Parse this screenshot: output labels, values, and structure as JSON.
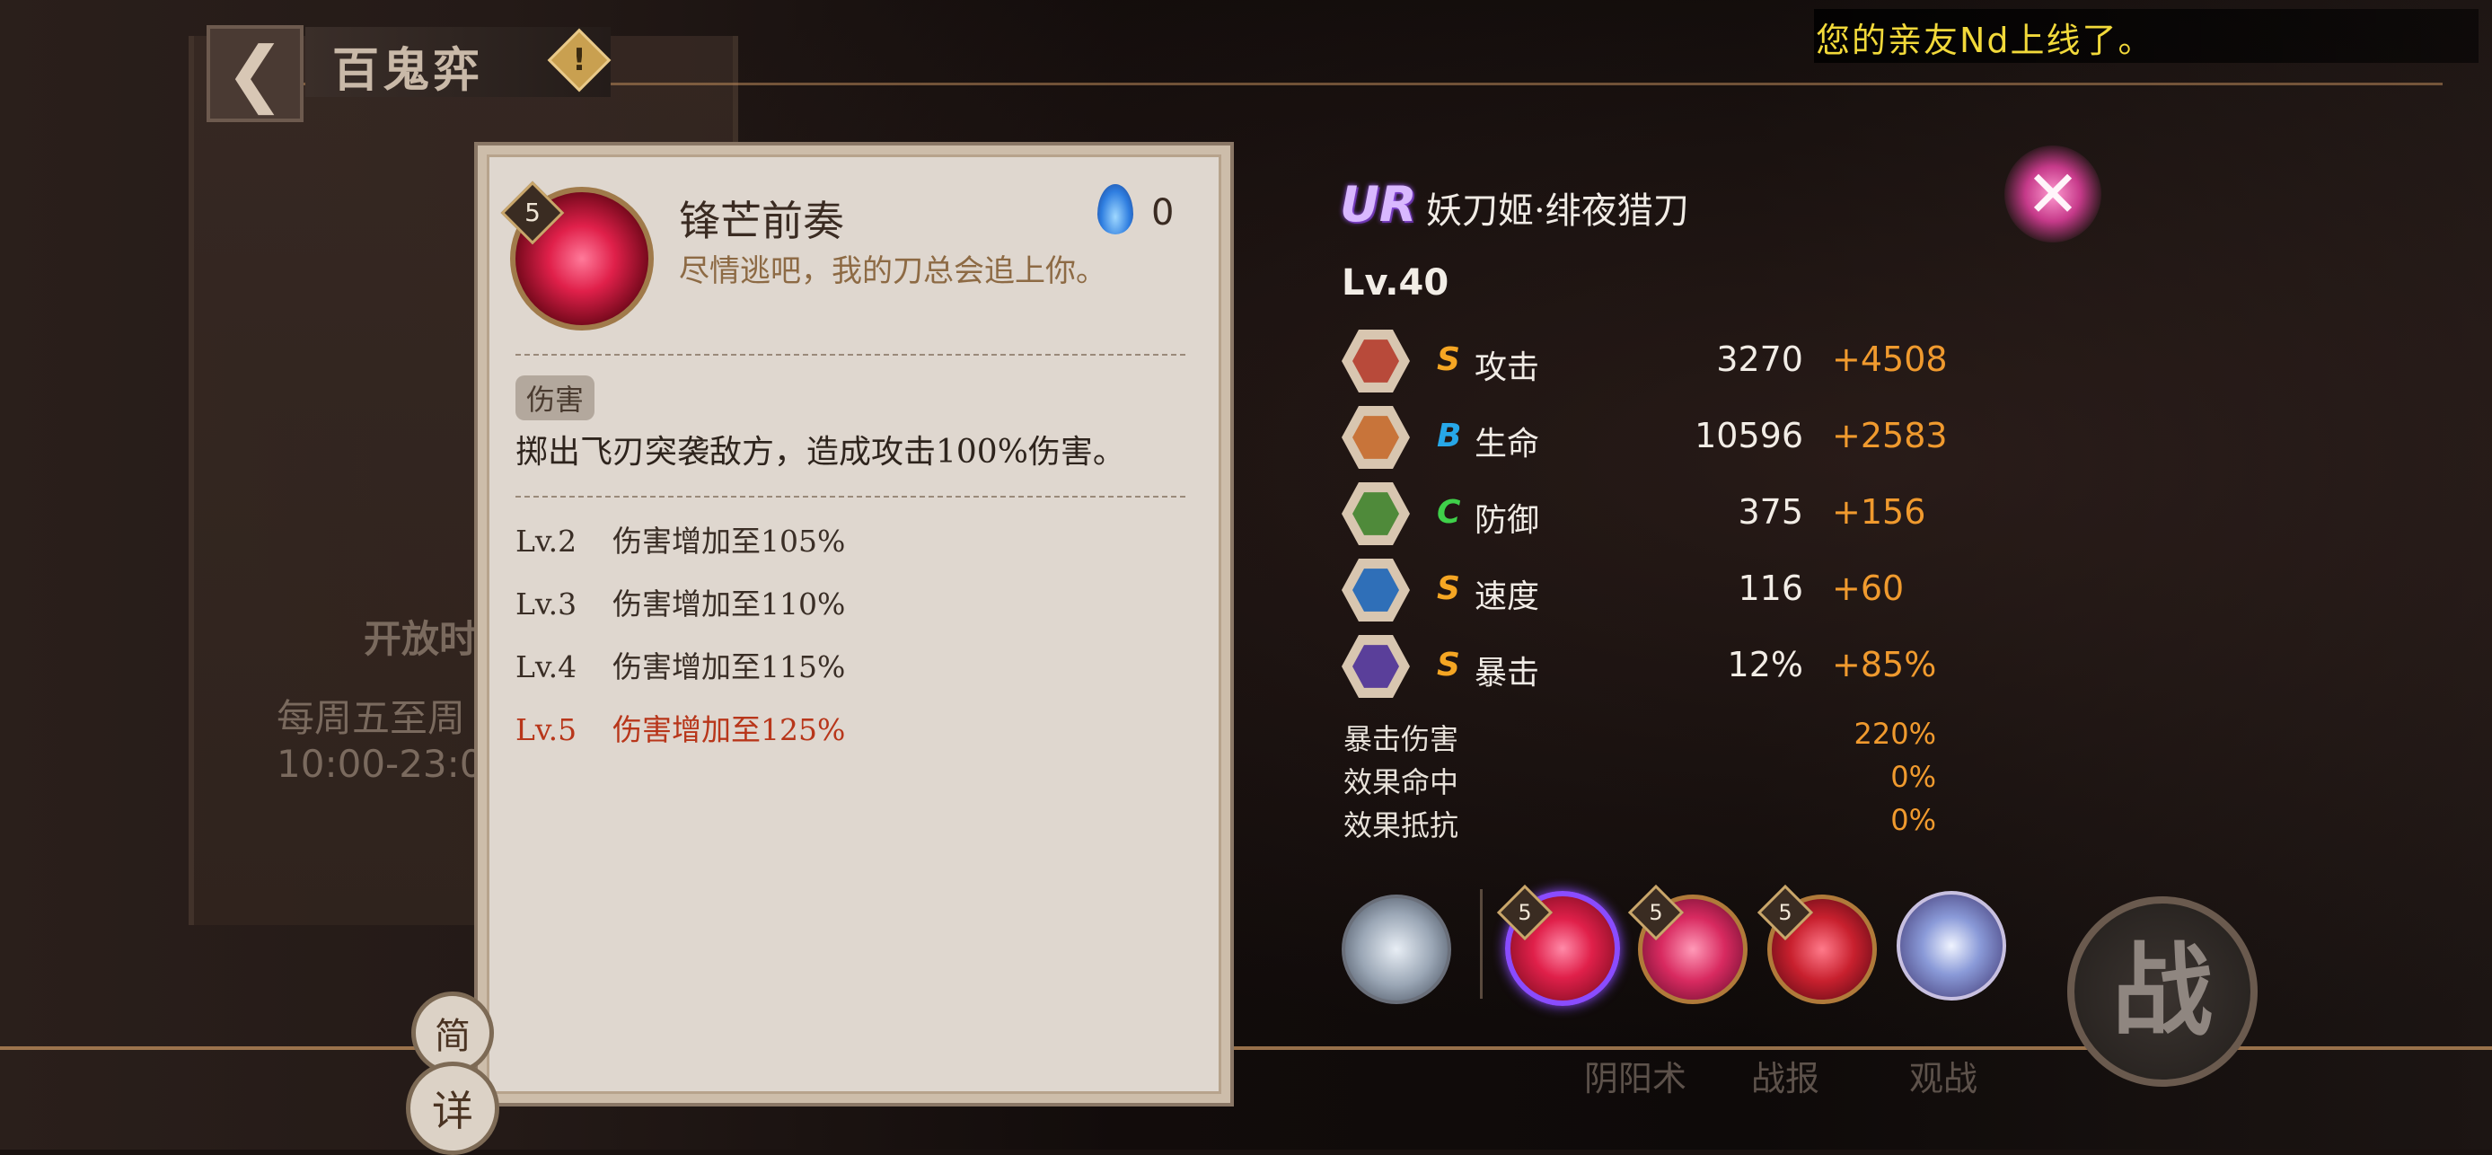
{
  "header": {
    "back_glyph": "❮",
    "title": "百鬼弈",
    "info_glyph": "!",
    "notice": "您的亲友Nd上线了。"
  },
  "background": {
    "open_time_label": "开放时",
    "schedule_line1": "每周五至周",
    "schedule_line2": "10:00-23:0"
  },
  "skill_card": {
    "level": "5",
    "name": "锋芒前奏",
    "quote": "尽情逃吧，我的刀总会追上你。",
    "cost_icon": "soul-fire-icon",
    "cost": "0",
    "tag": "伤害",
    "description": "掷出飞刃突袭敌方，造成攻击100%伤害。",
    "upgrades": [
      {
        "lv": "Lv.2",
        "text": "伤害增加至105%"
      },
      {
        "lv": "Lv.3",
        "text": "伤害增加至110%"
      },
      {
        "lv": "Lv.4",
        "text": "伤害增加至115%"
      },
      {
        "lv": "Lv.5",
        "text": "伤害增加至125%"
      }
    ]
  },
  "view_toggle": {
    "simple": "简",
    "detail": "详"
  },
  "character": {
    "rarity": "UR",
    "name": "妖刀姬·绯夜猎刀",
    "level": "Lv.40",
    "close_glyph": "✕",
    "stats": [
      {
        "icon": "attack-icon",
        "grade": "S",
        "grade_color": "#f5a623",
        "name": "攻击",
        "base": "3270",
        "bonus": "+4508"
      },
      {
        "icon": "health-icon",
        "grade": "B",
        "grade_color": "#27a7e8",
        "name": "生命",
        "base": "10596",
        "bonus": "+2583"
      },
      {
        "icon": "defense-icon",
        "grade": "C",
        "grade_color": "#3fd04a",
        "name": "防御",
        "base": "375",
        "bonus": "+156"
      },
      {
        "icon": "speed-icon",
        "grade": "S",
        "grade_color": "#f5a623",
        "name": "速度",
        "base": "116",
        "bonus": "+60"
      },
      {
        "icon": "crit-icon",
        "grade": "S",
        "grade_color": "#f5a623",
        "name": "暴击",
        "base": "12%",
        "bonus": "+85%"
      }
    ],
    "sub_stats": [
      {
        "name": "暴击伤害",
        "value": "220%"
      },
      {
        "name": "效果命中",
        "value": "0%"
      },
      {
        "name": "效果抵抗",
        "value": "0%"
      }
    ],
    "skills": [
      {
        "icon": "passive-skill-icon",
        "level": ""
      },
      {
        "icon": "blade-skill-icon",
        "level": "5",
        "selected": true
      },
      {
        "icon": "crimson-skill-icon",
        "level": "5"
      },
      {
        "icon": "flame-slash-skill-icon",
        "level": "5"
      },
      {
        "icon": "wheel-skill-icon",
        "level": ""
      }
    ]
  },
  "bottom": {
    "battle": "战",
    "labels": [
      "阴阳术",
      "战报",
      "观战"
    ]
  },
  "colors": {
    "bonus": "#f09a2e",
    "active_level": "#b8361a",
    "notice": "#f2d93a"
  }
}
